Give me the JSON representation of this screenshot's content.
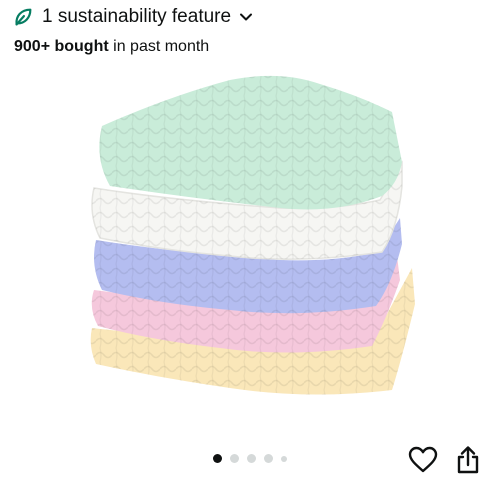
{
  "sustainability": {
    "count_label": "1 sustainability feature",
    "icon": "leaf-icon",
    "expand_icon": "chevron-down-icon",
    "color": "#067d62"
  },
  "social_proof": {
    "bold": "900+ bought",
    "rest": "in past month"
  },
  "product_image": {
    "description_icon": "muslin-washcloth-stack",
    "cloth_colors": [
      "#c9ecd9",
      "#f6f6f3",
      "#b4bdf0",
      "#f5c8dc",
      "#fae7b9"
    ]
  },
  "carousel": {
    "total_dots": 5,
    "active_index": 0
  },
  "actions": {
    "favorite_icon": "heart-icon",
    "share_icon": "share-icon"
  }
}
